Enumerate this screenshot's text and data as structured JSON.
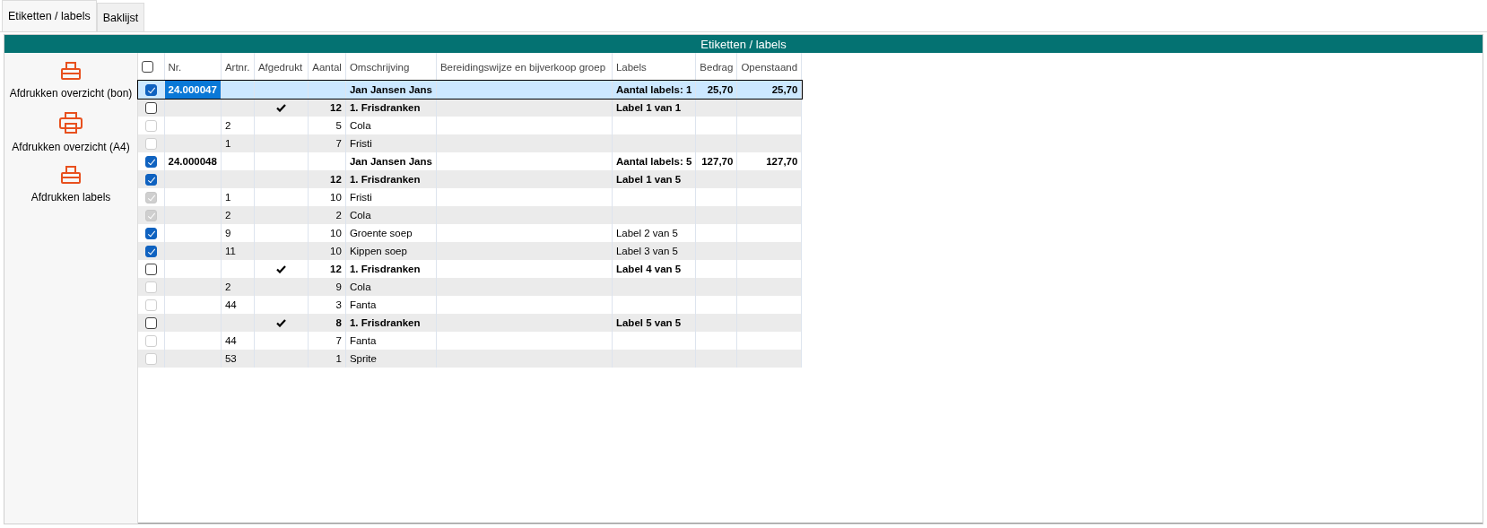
{
  "tabs": [
    {
      "label": "Etiketten / labels",
      "selected": true
    },
    {
      "label": "Baklijst",
      "selected": false
    }
  ],
  "panel_title": "Etiketten / labels",
  "actions": [
    {
      "label": "Afdrukken overzicht (bon)",
      "kind": "small"
    },
    {
      "label": "Afdrukken overzicht (A4)",
      "kind": "large"
    },
    {
      "label": "Afdrukken labels",
      "kind": "small"
    }
  ],
  "table": {
    "header_checked": false,
    "columns": [
      "Nr.",
      "Artnr.",
      "Afgedrukt",
      "Aantal",
      "Omschrijving",
      "Bereidingswijze en bijverkoop groep",
      "Labels",
      "Bedrag",
      "Openstaand"
    ],
    "rows": [
      {
        "kind": "order",
        "selected": true,
        "checked": true,
        "disabled": false,
        "printed": false,
        "nr": "24.000047",
        "description": "Jan Jansen Jans",
        "labels": "Aantal labels: 1",
        "amount": "25,70",
        "outstanding": "25,70"
      },
      {
        "kind": "group",
        "selected": false,
        "checked": false,
        "disabled": false,
        "printed": true,
        "quantity": "12",
        "description": "1. Frisdranken",
        "labels": "Label 1 van 1"
      },
      {
        "kind": "item",
        "selected": false,
        "checked": false,
        "disabled": true,
        "printed": false,
        "article": "2",
        "quantity": "5",
        "description": "Cola"
      },
      {
        "kind": "item",
        "selected": false,
        "checked": false,
        "disabled": true,
        "printed": false,
        "article": "1",
        "quantity": "7",
        "description": "Fristi"
      },
      {
        "kind": "order",
        "selected": false,
        "checked": true,
        "disabled": false,
        "printed": false,
        "nr": "24.000048",
        "description": "Jan Jansen Jans",
        "labels": "Aantal labels: 5",
        "amount": "127,70",
        "outstanding": "127,70"
      },
      {
        "kind": "group",
        "selected": false,
        "checked": true,
        "disabled": false,
        "printed": false,
        "quantity": "12",
        "description": "1. Frisdranken",
        "labels": "Label 1 van 5"
      },
      {
        "kind": "item",
        "selected": false,
        "checked": true,
        "disabled": true,
        "printed": false,
        "article": "1",
        "quantity": "10",
        "description": "Fristi"
      },
      {
        "kind": "item",
        "selected": false,
        "checked": true,
        "disabled": true,
        "printed": false,
        "article": "2",
        "quantity": "2",
        "description": "Cola"
      },
      {
        "kind": "item",
        "selected": false,
        "checked": true,
        "disabled": false,
        "printed": false,
        "article": "9",
        "quantity": "10",
        "description": "Groente soep",
        "labels": "Label 2 van 5"
      },
      {
        "kind": "item",
        "selected": false,
        "checked": true,
        "disabled": false,
        "printed": false,
        "article": "11",
        "quantity": "10",
        "description": "Kippen soep",
        "labels": "Label 3 van 5"
      },
      {
        "kind": "group",
        "selected": false,
        "checked": false,
        "disabled": false,
        "printed": true,
        "quantity": "12",
        "description": "1. Frisdranken",
        "labels": "Label 4 van 5"
      },
      {
        "kind": "item",
        "selected": false,
        "checked": false,
        "disabled": true,
        "printed": false,
        "article": "2",
        "quantity": "9",
        "description": "Cola"
      },
      {
        "kind": "item",
        "selected": false,
        "checked": false,
        "disabled": true,
        "printed": false,
        "article": "44",
        "quantity": "3",
        "description": "Fanta"
      },
      {
        "kind": "group",
        "selected": false,
        "checked": false,
        "disabled": false,
        "printed": true,
        "quantity": "8",
        "description": "1. Frisdranken",
        "labels": "Label 5 van 5"
      },
      {
        "kind": "item",
        "selected": false,
        "checked": false,
        "disabled": true,
        "printed": false,
        "article": "44",
        "quantity": "7",
        "description": "Fanta"
      },
      {
        "kind": "item",
        "selected": false,
        "checked": false,
        "disabled": true,
        "printed": false,
        "article": "53",
        "quantity": "1",
        "description": "Sprite"
      }
    ]
  }
}
